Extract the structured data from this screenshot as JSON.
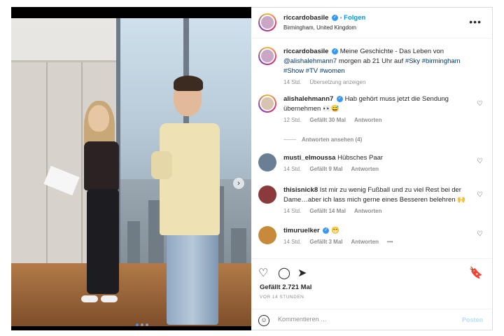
{
  "post": {
    "author": "riccardobasile",
    "follow_label": "Folgen",
    "separator": "•",
    "location": "Birmingham, United Kingdom",
    "more_icon": "more-horizontal-icon"
  },
  "caption": {
    "author": "riccardobasile",
    "text_before": "Meine Geschichte - Das Leben von",
    "mention": "@alishalehmann7",
    "text_after": "morgen ab 21 Uhr auf",
    "hashtags_line1": "#Sky #birmingham",
    "hashtags_line2": "#Show #TV #women",
    "time": "14 Std.",
    "translate": "Übersetzung anzeigen"
  },
  "comments": [
    {
      "author": "alishalehmann7",
      "verified": true,
      "text": "Hab gehört muss jetzt die Sendung übernehmen 👀😅",
      "time": "12 Std.",
      "likes": "Gefällt 30 Mal",
      "reply": "Antworten",
      "view_replies": "Antworten ansehen (4)"
    },
    {
      "author": "musti_elmoussa",
      "verified": false,
      "text": "Hübsches Paar",
      "time": "14 Std.",
      "likes": "Gefällt 9 Mal",
      "reply": "Antworten"
    },
    {
      "author": "thisisnick8",
      "verified": false,
      "text": "Ist mir zu wenig Fußball und zu viel Rest bei der Dame…aber ich lass mich gerne eines Besseren belehren 🙌",
      "time": "14 Std.",
      "likes": "Gefällt 14 Mal",
      "reply": "Antworten"
    },
    {
      "author": "timuruelker",
      "verified": true,
      "text": "😁",
      "time": "14 Std.",
      "likes": "Gefällt 3 Mal",
      "reply": "Antworten",
      "more": "•••"
    }
  ],
  "actions": {
    "like_icon": "heart-icon",
    "comment_icon": "comment-icon",
    "share_icon": "share-icon",
    "save_icon": "bookmark-icon"
  },
  "likes_total": "Gefällt 2.721 Mal",
  "posted_ago": "VOR 14 STUNDEN",
  "composer": {
    "placeholder": "Kommentieren …",
    "post_label": "Posten",
    "emoji_icon": "emoji-icon"
  },
  "colors": {
    "link": "#00376b",
    "follow": "#0095f6",
    "muted": "#8e8e8e",
    "verified": "#3897f0"
  }
}
